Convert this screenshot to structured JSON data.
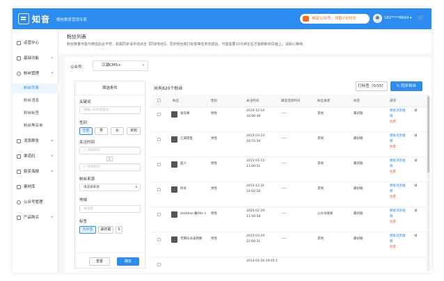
{
  "topbar": {
    "logo_text": "知音",
    "logo_sub": "微信教育营销专家",
    "promo": "绑定公众号，领取7天时长",
    "username": "182****8664",
    "caret": "▾",
    "cart_icon": "cart-icon"
  },
  "sidebar": {
    "items": [
      {
        "label": "运营中心",
        "icon": "dashboard-icon",
        "arrow": ""
      },
      {
        "label": "基础功能",
        "icon": "grid-icon",
        "arrow": "▸"
      },
      {
        "label": "粉丝管理",
        "icon": "heart-icon",
        "arrow": "▾"
      },
      {
        "label": "消息群发",
        "icon": "message-icon",
        "arrow": "▸"
      },
      {
        "label": "渠道码",
        "icon": "qrcode-icon",
        "arrow": "▸"
      },
      {
        "label": "裂变海报",
        "icon": "poster-icon",
        "arrow": "▸"
      },
      {
        "label": "素材库",
        "icon": "folder-icon",
        "arrow": ""
      },
      {
        "label": "公众号管理",
        "icon": "account-icon",
        "arrow": ""
      },
      {
        "label": "产品购买",
        "icon": "cart-icon",
        "arrow": "▸"
      }
    ],
    "sub_items": [
      "粉丝列表",
      "粉丝消息",
      "粉丝标签",
      "粉丝黑名单"
    ]
  },
  "page": {
    "title": "粉丝列表",
    "notice": "粉丝数量可能与微信后台不符，如需同步请手动点击【同步粉丝】。同步粉丝和打标签等任务完成后，可能需要10分钟左右才能刷新到页面上，请耐心等待。"
  },
  "account": {
    "label": "公众号：",
    "value": "江湖CMS+",
    "caret": "▾"
  },
  "filter": {
    "title": "筛选条件",
    "keyword_label": "关键词",
    "keyword_placeholder": "请输入昵称或备注",
    "gender_label": "性别",
    "gender_options": [
      "全部",
      "男",
      "女",
      "未知"
    ],
    "follow_label": "关注时间",
    "start_placeholder": "开始时间",
    "end_placeholder": "结束时间",
    "sep": "至",
    "source_label": "粉丝来源",
    "source_value": "请选择来源",
    "region_label": "地域",
    "region_placeholder": "请选择",
    "tag_label": "标签",
    "tag_options": [
      "无标签",
      "最初聪",
      "S"
    ],
    "reset": "重置",
    "confirm": "确定"
  },
  "table": {
    "total": "共有820个粉丝",
    "label_button": "打标签（0/15）",
    "sync_button": "同步粉丝",
    "headers": [
      "粉丝",
      "性别",
      "关注时间",
      "最后活跃时间",
      "粉丝来源",
      "标签",
      "操作"
    ],
    "rows": [
      {
        "name": "张云峰",
        "gender": "男性",
        "time": "2014-12-10 16:06:49",
        "active": "-----",
        "source": "其他",
        "tag": "最初聪",
        "op1": "模板消息推",
        "op2": "情",
        "op3": "拉黑",
        "op4": "详"
      },
      {
        "name": "江湖游医",
        "gender": "男性",
        "time": "2015-03-23 18:55:59",
        "active": "-----",
        "source": "其他",
        "tag": "最初聪",
        "op1": "模板消息推",
        "op2": "情",
        "op3": "拉黑",
        "op4": "详"
      },
      {
        "name": "超人",
        "gender": "男性",
        "time": "2015-01-15 11:00:51",
        "active": "-----",
        "source": "其他",
        "tag": "最初聪",
        "op1": "模板消息推",
        "op2": "情",
        "op3": "拉黑",
        "op4": "详"
      },
      {
        "name": "阿冬",
        "gender": "男性",
        "time": "2013-12-31 14:02:26",
        "active": "-----",
        "source": "其他",
        "tag": "最初聪",
        "op1": "模板消息推",
        "op2": "情",
        "op3": "拉黑",
        "op4": "详"
      },
      {
        "name": "shellbox-戴Alle n",
        "gender": "男性",
        "time": "2020-02-29 11:56:58",
        "active": "-----",
        "source": "公众号搜索",
        "tag": "最初聪",
        "op1": "模板消息推",
        "op2": "情",
        "op3": "拉黑",
        "op4": "详"
      },
      {
        "name": "无锡乐派美明路",
        "gender": "男性",
        "time": "2015-03-24 12:06:31",
        "active": "-----",
        "source": "其他",
        "tag": "最初聪",
        "op1": "模板消息推",
        "op2": "情",
        "op3": "拉黑",
        "op4": "详"
      },
      {
        "name": "",
        "gender": "",
        "time": "2014-01-26 19:05:1",
        "active": "",
        "source": "",
        "tag": "",
        "op1": "",
        "op2": "",
        "op3": "",
        "op4": ""
      }
    ]
  },
  "colors": {
    "accent": "#2d8cf0",
    "promo": "#f56c1a",
    "danger": "#e64a3c"
  }
}
